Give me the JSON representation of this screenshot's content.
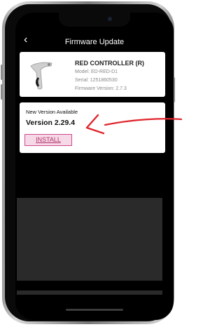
{
  "nav": {
    "back_icon": "chevron-left-icon",
    "back_glyph": "‹",
    "title": "Firmware Update"
  },
  "device": {
    "icon": "shifter-controller-icon",
    "name": "RED CONTROLLER (R)",
    "model": "Model: ED-RED-D1",
    "serial": "Serial: 1251860530",
    "firmware": "Firmware Version: 2.7.3"
  },
  "update": {
    "heading": "New Version Available",
    "version": "Version 2.29.4",
    "install_label": "INSTALL"
  },
  "colors": {
    "accent": "#d04a8e",
    "install_bg": "#f6d9e6",
    "annotation_arrow": "#e0242c"
  }
}
